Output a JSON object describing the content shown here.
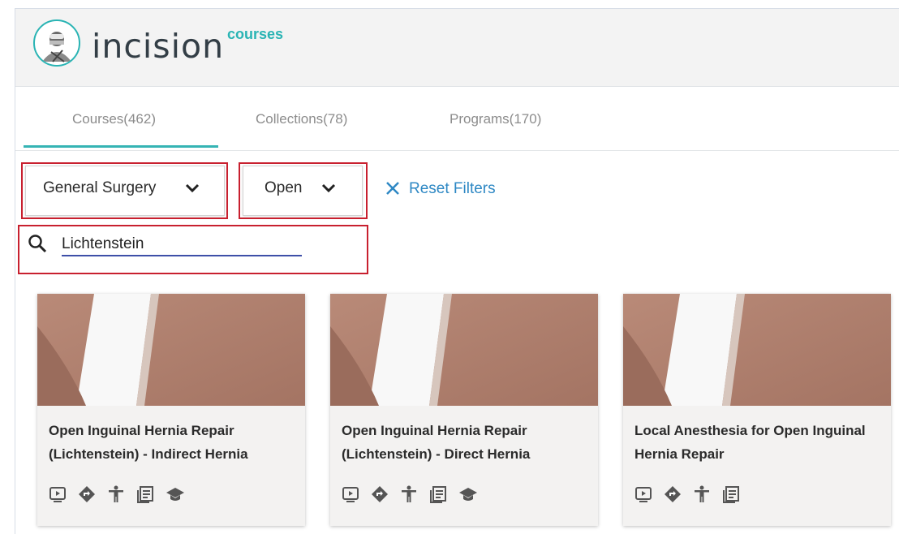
{
  "header": {
    "logo_text": "incision",
    "logo_sub": "courses"
  },
  "tabs": [
    {
      "label": "Courses(462)",
      "active": true
    },
    {
      "label": "Collections(78)",
      "active": false
    },
    {
      "label": "Programs(170)",
      "active": false
    }
  ],
  "filters": {
    "specialty": "General Surgery",
    "approach": "Open",
    "reset_label": "Reset Filters"
  },
  "search": {
    "value": "Lichtenstein"
  },
  "cards": [
    {
      "title": "Open Inguinal Hernia Repair (Lichtenstein) - Indirect Hernia",
      "icons": [
        "video-icon",
        "diamond-direction-icon",
        "person-icon",
        "document-icon",
        "graduation-cap-icon"
      ]
    },
    {
      "title": "Open Inguinal Hernia Repair (Lichtenstein) - Direct Hernia",
      "icons": [
        "video-icon",
        "diamond-direction-icon",
        "person-icon",
        "document-icon",
        "graduation-cap-icon"
      ]
    },
    {
      "title": "Local Anesthesia for Open Inguinal Hernia Repair",
      "icons": [
        "video-icon",
        "diamond-direction-icon",
        "person-icon",
        "document-icon"
      ]
    }
  ],
  "colors": {
    "accent": "#2ab4b4",
    "link": "#2e88c4",
    "highlight": "#c8202f"
  }
}
